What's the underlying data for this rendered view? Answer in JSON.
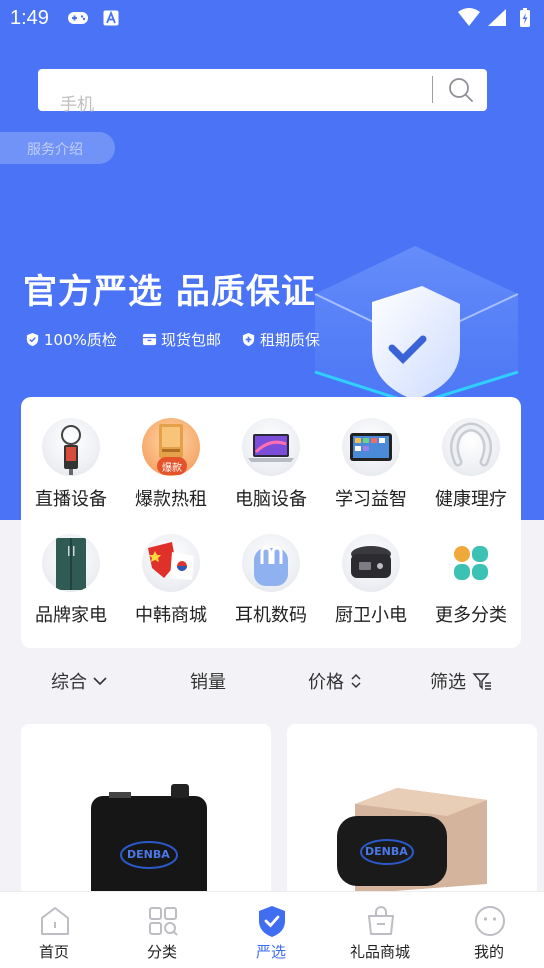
{
  "status_bar": {
    "time": "1:49",
    "icons": [
      "gamepad-icon",
      "a-icon",
      "wifi-icon",
      "signal-icon",
      "battery-icon"
    ]
  },
  "search": {
    "placeholder": "手机",
    "icon": "search-icon"
  },
  "service_tag": {
    "label": "服务介绍"
  },
  "banner": {
    "headline": "官方严选 品质保证",
    "features": [
      {
        "icon": "shield-check-icon",
        "label": "100%质检"
      },
      {
        "icon": "box-icon",
        "label": "现货包邮"
      },
      {
        "icon": "shield-plus-icon",
        "label": "租期质保"
      }
    ]
  },
  "categories": [
    {
      "label": "直播设备",
      "icon": "live-stream-device-icon"
    },
    {
      "label": "爆款热租",
      "icon": "hot-rental-icon",
      "badge": "爆款"
    },
    {
      "label": "电脑设备",
      "icon": "laptop-icon"
    },
    {
      "label": "学习益智",
      "icon": "tablet-icon"
    },
    {
      "label": "健康理疗",
      "icon": "neck-massager-icon"
    },
    {
      "label": "品牌家电",
      "icon": "refrigerator-icon"
    },
    {
      "label": "中韩商城",
      "icon": "china-korea-flag-icon"
    },
    {
      "label": "耳机数码",
      "icon": "earbuds-icon"
    },
    {
      "label": "厨卫小电",
      "icon": "rice-cooker-icon"
    },
    {
      "label": "更多分类",
      "icon": "more-categories-icon"
    }
  ],
  "sort_bar": {
    "items": [
      {
        "label": "综合",
        "icon": "chevron-down-icon"
      },
      {
        "label": "销量"
      },
      {
        "label": "价格",
        "icon": "sort-updown-icon"
      },
      {
        "label": "筛选",
        "icon": "filter-icon"
      }
    ]
  },
  "products": [
    {
      "brand_logo": "DENBA",
      "icon": "denba-black-device-image"
    },
    {
      "brand_logo": "DENBA",
      "icon": "denba-gold-device-image"
    }
  ],
  "tab_bar": {
    "active": 2,
    "tabs": [
      {
        "label": "首页",
        "icon": "home-icon"
      },
      {
        "label": "分类",
        "icon": "category-grid-icon"
      },
      {
        "label": "严选",
        "icon": "shield-check-icon"
      },
      {
        "label": "礼品商城",
        "icon": "gift-bag-icon"
      },
      {
        "label": "我的",
        "icon": "profile-face-icon"
      }
    ]
  },
  "colors": {
    "primary": "#4a74f5",
    "tab_active": "#3f6ff0",
    "background": "#f3f3f7",
    "hot_badge": "#e5532a"
  }
}
